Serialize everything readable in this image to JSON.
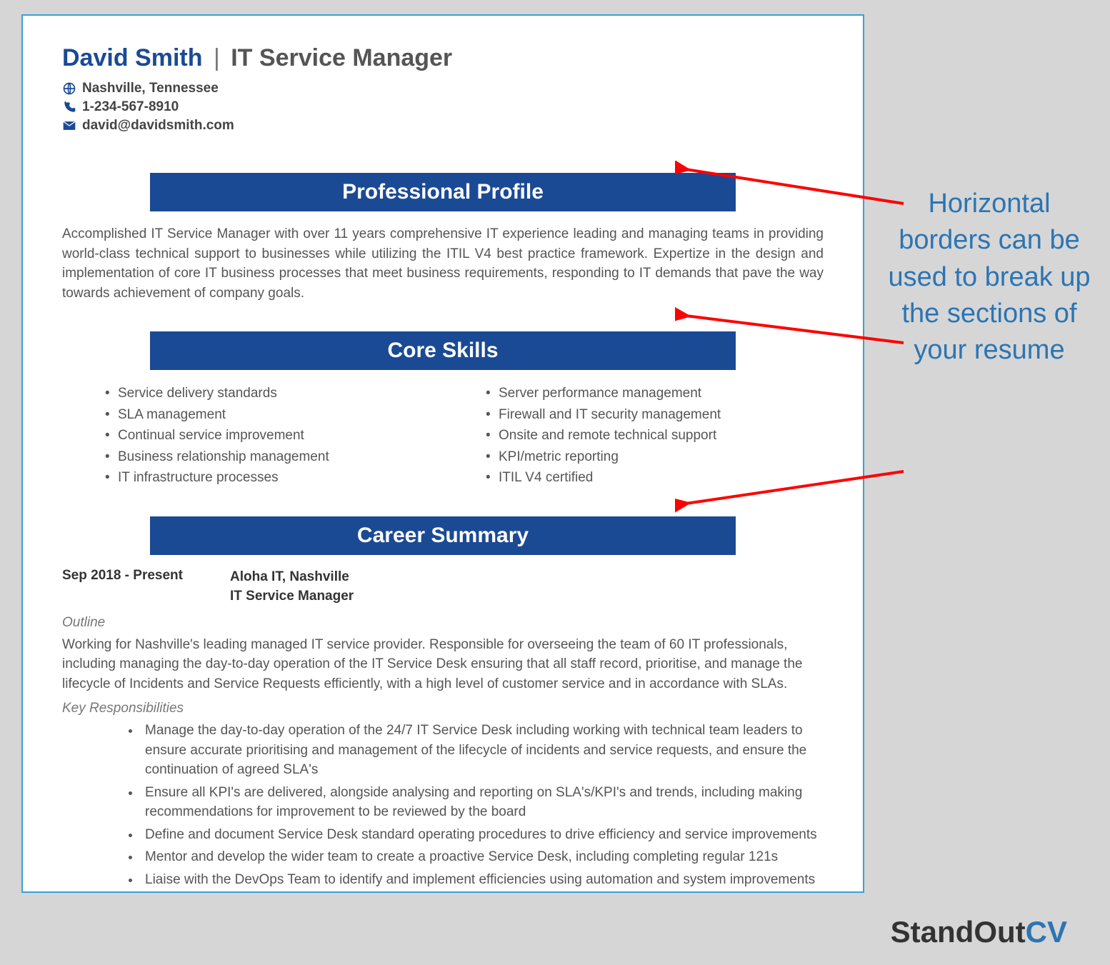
{
  "header": {
    "name": "David Smith",
    "title": "IT Service Manager",
    "location": "Nashville, Tennessee",
    "phone": "1-234-567-8910",
    "email": "david@davidsmith.com"
  },
  "sections": {
    "profile_title": "Professional Profile",
    "skills_title": "Core Skills",
    "career_title": "Career Summary"
  },
  "profile_text": "Accomplished IT Service Manager with over 11 years comprehensive IT experience leading and managing teams in providing world-class technical support to businesses while utilizing the ITIL V4 best practice framework. Expertize in the design and implementation of core IT business processes that meet business requirements, responding to IT demands that pave the way towards achievement of company goals.",
  "skills_left": [
    "Service delivery standards",
    "SLA management",
    "Continual service improvement",
    "Business relationship management",
    "IT infrastructure processes"
  ],
  "skills_right": [
    "Server performance management",
    "Firewall and IT security management",
    "Onsite and remote technical support",
    "KPI/metric reporting",
    "ITIL V4 certified"
  ],
  "job": {
    "date": "Sep 2018 - Present",
    "company": "Aloha IT, Nashville",
    "role": "IT Service Manager",
    "outline_label": "Outline",
    "outline_text": "Working for Nashville's leading managed IT service provider. Responsible for overseeing the team of 60 IT professionals, including managing the day-to-day operation of the IT Service Desk ensuring that all staff record, prioritise, and manage the lifecycle of Incidents and Service Requests efficiently, with a high level of customer service and in accordance with SLAs.",
    "resp_label": "Key Responsibilities",
    "responsibilities": [
      "Manage the day-to-day operation of the 24/7 IT Service Desk including working with technical team leaders to ensure accurate prioritising and management of the lifecycle of incidents and service requests, and ensure the continuation of agreed SLA's",
      "Ensure all KPI's are delivered, alongside analysing and reporting on SLA's/KPI's and trends, including making recommendations for improvement to be reviewed by the board",
      "Define and document Service Desk standard operating procedures to drive efficiency and service improvements",
      "Mentor and develop the wider team to create a proactive Service Desk, including completing regular 121s",
      "Liaise with the DevOps Team to identify and implement efficiencies using automation and system improvements"
    ]
  },
  "annotation_text": "Horizontal borders can be used to break up the sections of your resume",
  "brand": {
    "part1": "StandOut",
    "part2": "CV"
  }
}
